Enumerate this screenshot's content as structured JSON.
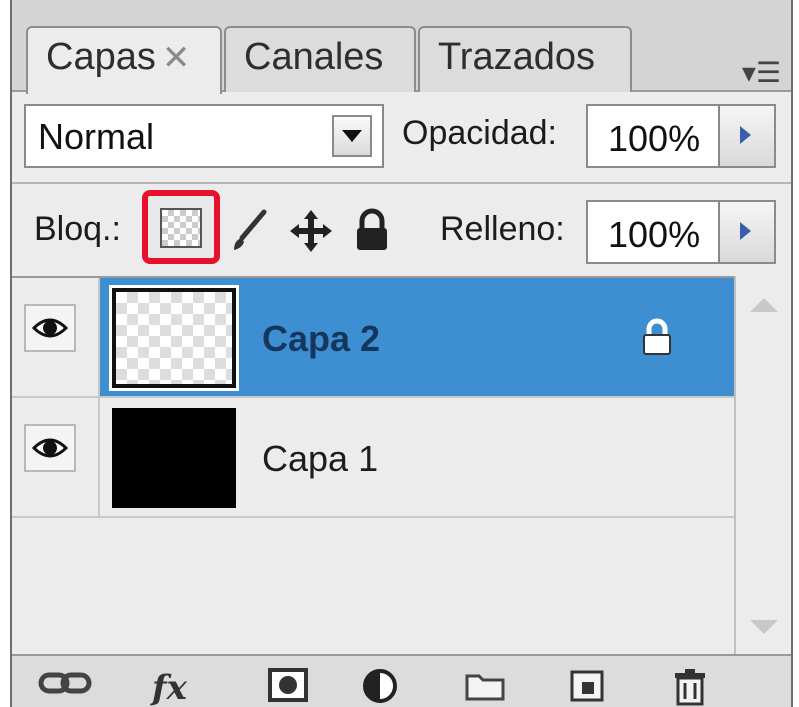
{
  "tabs": [
    {
      "label": "Capas",
      "active": true
    },
    {
      "label": "Canales",
      "active": false
    },
    {
      "label": "Trazados",
      "active": false
    }
  ],
  "blend_mode": "Normal",
  "opacity": {
    "label": "Opacidad:",
    "value": "100%"
  },
  "lock": {
    "label": "Bloq.:"
  },
  "fill": {
    "label": "Relleno:",
    "value": "100%"
  },
  "layers": [
    {
      "name": "Capa 2",
      "selected": true,
      "locked": true,
      "thumbnail": "transparent"
    },
    {
      "name": "Capa 1",
      "selected": false,
      "locked": false,
      "thumbnail": "black"
    }
  ],
  "colors": {
    "selection": "#3d8fd2",
    "highlight": "#e8112d"
  },
  "icons": [
    "close-icon",
    "panel-menu-icon",
    "lock-transparent-icon",
    "brush-icon",
    "move-icon",
    "lock-all-icon",
    "eye-icon",
    "link-icon",
    "fx-icon",
    "mask-icon",
    "adjustment-icon",
    "folder-icon",
    "new-layer-icon",
    "trash-icon"
  ]
}
